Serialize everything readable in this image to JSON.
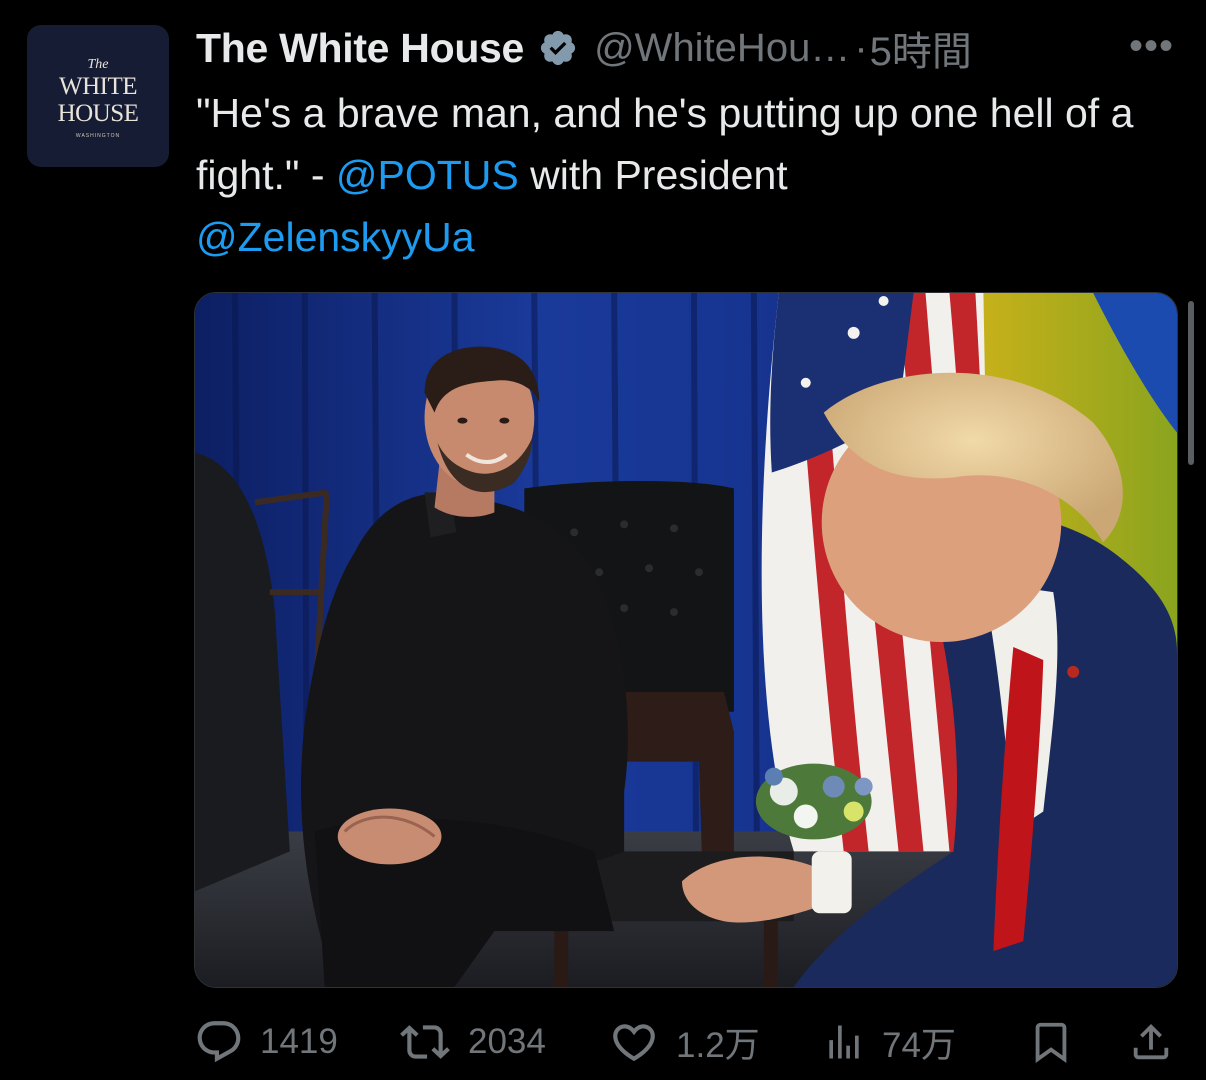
{
  "account": {
    "avatar_line1": "The",
    "avatar_line2": "WHITE",
    "avatar_line3": "HOUSE",
    "avatar_line4": "WASHINGTON",
    "display_name": "The White House",
    "handle": "@WhiteHou…",
    "separator": "·",
    "time": "5時間",
    "more_label": "•••",
    "verified_icon": "verified-badge-icon"
  },
  "tweet": {
    "text_before": "\"He's a brave man, and he's putting up one hell of a fight.\" - ",
    "mention1": "@POTUS",
    "text_middle": " with President ",
    "mention2": "@ZelenskyyUa"
  },
  "media": {
    "type": "photo"
  },
  "actions": {
    "reply_count": "1419",
    "retweet_count": "2034",
    "like_count": "1.2万",
    "views_count": "74万",
    "icons": [
      "reply-icon",
      "retweet-icon",
      "like-icon",
      "views-icon",
      "bookmark-icon",
      "share-icon"
    ]
  },
  "colors": {
    "background": "#000000",
    "text": "#e7e9ea",
    "muted": "#71767b",
    "accent": "#1d9bf0"
  }
}
